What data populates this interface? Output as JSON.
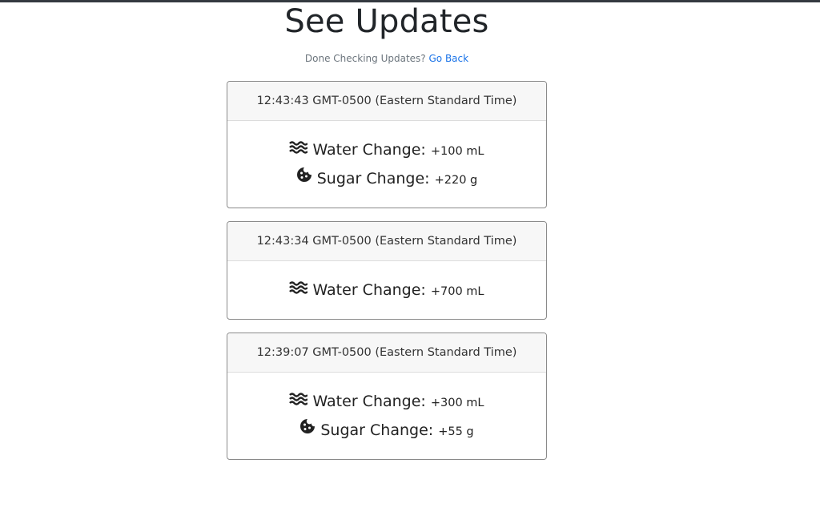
{
  "page": {
    "title": "See Updates",
    "subtitle_prefix": "Done Checking Updates?",
    "go_back_label": "Go Back"
  },
  "updates": [
    {
      "timestamp": "12:43:43 GMT-0500 (Eastern Standard Time)",
      "changes": [
        {
          "icon": "water-icon",
          "label": "Water Change:",
          "value": "+100 mL"
        },
        {
          "icon": "cookie-icon",
          "label": "Sugar Change:",
          "value": "+220 g"
        }
      ]
    },
    {
      "timestamp": "12:43:34 GMT-0500 (Eastern Standard Time)",
      "changes": [
        {
          "icon": "water-icon",
          "label": "Water Change:",
          "value": "+700 mL"
        }
      ]
    },
    {
      "timestamp": "12:39:07 GMT-0500 (Eastern Standard Time)",
      "changes": [
        {
          "icon": "water-icon",
          "label": "Water Change:",
          "value": "+300 mL"
        },
        {
          "icon": "cookie-icon",
          "label": "Sugar Change:",
          "value": "+55 g"
        }
      ]
    }
  ],
  "colors": {
    "topbar": "#343a40",
    "link": "#1a73e8",
    "card_header_bg": "#f7f7f7",
    "card_border": "#8a8a8a"
  }
}
